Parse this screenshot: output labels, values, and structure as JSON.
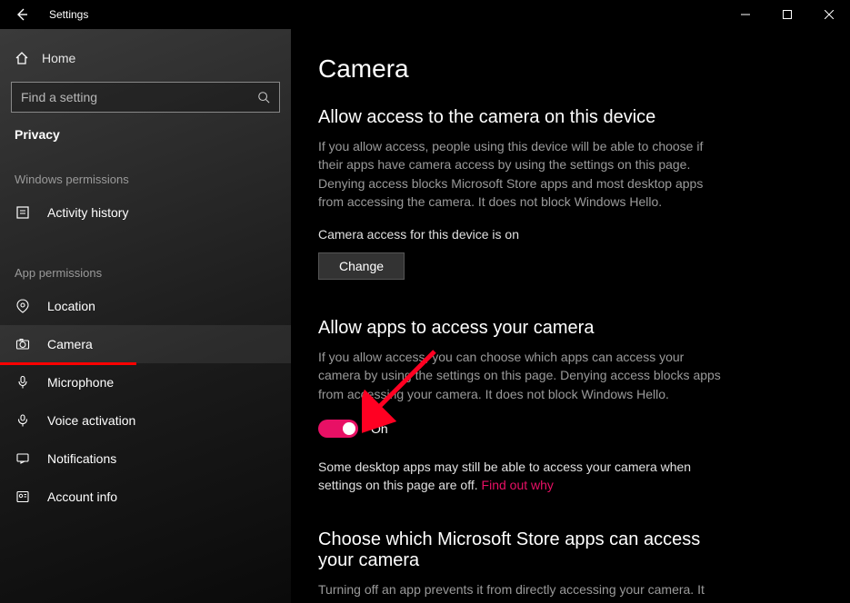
{
  "titlebar": {
    "label": "Settings"
  },
  "sidebar": {
    "home_label": "Home",
    "search_placeholder": "Find a setting",
    "category_label": "Privacy",
    "section_windows_perms": "Windows permissions",
    "section_app_perms": "App permissions",
    "items": {
      "activity_history": "Activity history",
      "location": "Location",
      "camera": "Camera",
      "microphone": "Microphone",
      "voice_activation": "Voice activation",
      "notifications": "Notifications",
      "account_info": "Account info"
    }
  },
  "content": {
    "page_title": "Camera",
    "section1": {
      "heading": "Allow access to the camera on this device",
      "body": "If you allow access, people using this device will be able to choose if their apps have camera access by using the settings on this page. Denying access blocks Microsoft Store apps and most desktop apps from accessing the camera. It does not block Windows Hello.",
      "status": "Camera access for this device is on",
      "change_btn": "Change"
    },
    "section2": {
      "heading": "Allow apps to access your camera",
      "body": "If you allow access, you can choose which apps can access your camera by using the settings on this page. Denying access blocks apps from accessing your camera. It does not block Windows Hello.",
      "toggle_state": "On",
      "note": "Some desktop apps may still be able to access your camera when settings on this page are off. ",
      "note_link": "Find out why"
    },
    "section3": {
      "heading": "Choose which Microsoft Store apps can access your camera",
      "body": "Turning off an app prevents it from directly accessing your camera. It"
    }
  },
  "colors": {
    "accent": "#e81065"
  }
}
